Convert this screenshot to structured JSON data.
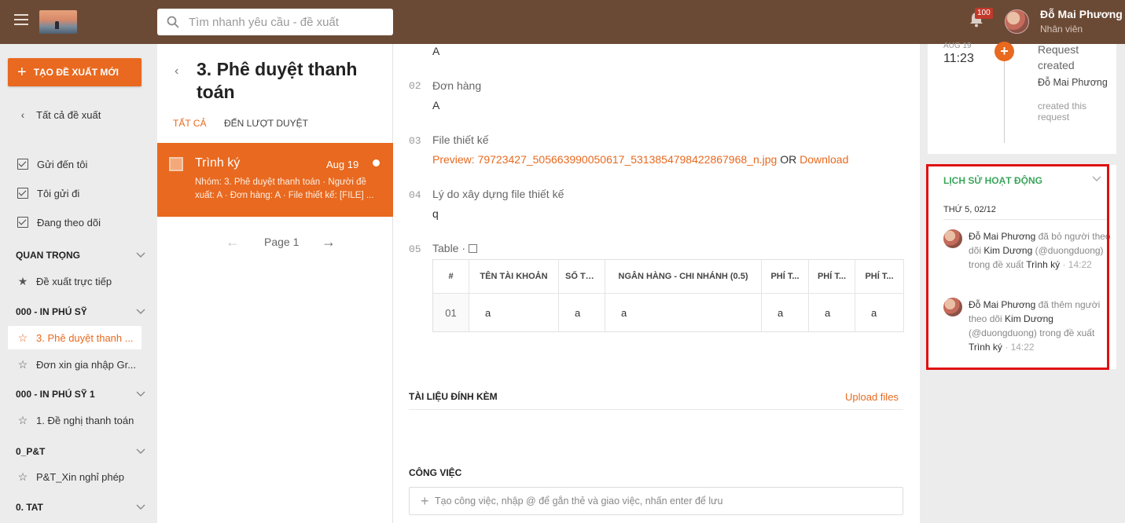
{
  "header": {
    "search_placeholder": "Tìm nhanh yêu cầu - đề xuất",
    "notification_count": "100",
    "user_name": "Đỗ Mai Phương",
    "user_role": "Nhân viên"
  },
  "sidebar": {
    "create_label": "TẠO ĐỀ XUẤT MỚI",
    "all_label": "Tất cả đề xuất",
    "filters": [
      {
        "label": "Gửi đến tôi"
      },
      {
        "label": "Tôi gửi đi"
      },
      {
        "label": "Đang theo dõi"
      }
    ],
    "groups": [
      {
        "title": "QUAN TRỌNG",
        "items": [
          {
            "label": "Đề xuất trực tiếp"
          }
        ]
      },
      {
        "title": "000 - IN PHÚ SỸ",
        "items": [
          {
            "label": "3. Phê duyệt thanh ..."
          },
          {
            "label": "Đơn xin gia nhập Gr..."
          }
        ]
      },
      {
        "title": "000 - IN PHÚ SỸ 1",
        "items": [
          {
            "label": "1. Đề nghị thanh toán"
          }
        ]
      },
      {
        "title": "0_P&T",
        "items": [
          {
            "label": "P&T_Xin nghỉ phép"
          }
        ]
      },
      {
        "title": "0. TAT",
        "items": []
      }
    ]
  },
  "list": {
    "title": "3. Phê duyệt thanh toán",
    "tabs": [
      "TẤT CẢ",
      "ĐẾN LƯỢT DUYỆT"
    ],
    "card": {
      "title": "Trình ký",
      "date": "Aug 19",
      "desc": "Nhóm: 3. Phê duyệt thanh toán · Người đề xuất: A · Đơn hàng: A · File thiết kế: [FILE] ..."
    },
    "page_label": "Page 1"
  },
  "main": {
    "top_value": "A",
    "fields": [
      {
        "num": "02",
        "label": "Đơn hàng",
        "value": "A"
      },
      {
        "num": "03",
        "label": "File thiết kế",
        "preview": "Preview: 79723427_505663990050617_5313854798422867968_n.jpg",
        "or": "OR",
        "download": "Download"
      },
      {
        "num": "04",
        "label": "Lý do xây dựng file thiết kế",
        "value": "q"
      },
      {
        "num": "05",
        "label": "Table ·"
      }
    ],
    "table": {
      "headers": [
        "#",
        "TÊN TÀI KHOẢN",
        "SỐ TÀ...",
        "NGÂN HÀNG - CHI NHÁNH (0.5)",
        "PHÍ T...",
        "PHÍ T...",
        "PHÍ T..."
      ],
      "rows": [
        [
          "01",
          "a",
          "a",
          "a",
          "a",
          "a",
          "a"
        ]
      ]
    },
    "attachments_title": "TÀI LIỆU ĐÍNH KÈM",
    "upload_label": "Upload files",
    "tasks_title": "CÔNG VIỆC",
    "task_placeholder": "Tạo công việc, nhập @ để gắn thẻ và giao việc, nhấn enter để lưu"
  },
  "timeline": {
    "month": "AUG 19",
    "time": "11:23",
    "event": "Request created",
    "actor": "Đỗ Mai Phương",
    "note": "created this request"
  },
  "activity": {
    "title": "LỊCH SỬ HOẠT ĐỘNG",
    "date": "THỨ 5, 02/12",
    "items": [
      {
        "actor": "Đỗ Mai Phương",
        "verb": "đã bỏ người theo dõi",
        "target": "Kim Dương",
        "handle": "(@duongduong)",
        "prep": "trong đề xuất",
        "object": "Trình ký",
        "time": "· 14:22"
      },
      {
        "actor": "Đỗ Mai Phương",
        "verb": "đã thêm người theo dõi",
        "target": "Kim Dương",
        "handle": "(@duongduong)",
        "prep": "trong đề xuất",
        "object": "Trình ký",
        "time": "· 14:22"
      }
    ]
  },
  "colors": {
    "topbar": "#6b4a35",
    "accent": "#e8691f",
    "activity_title": "#3aa55c",
    "highlight_border": "#e01010"
  }
}
